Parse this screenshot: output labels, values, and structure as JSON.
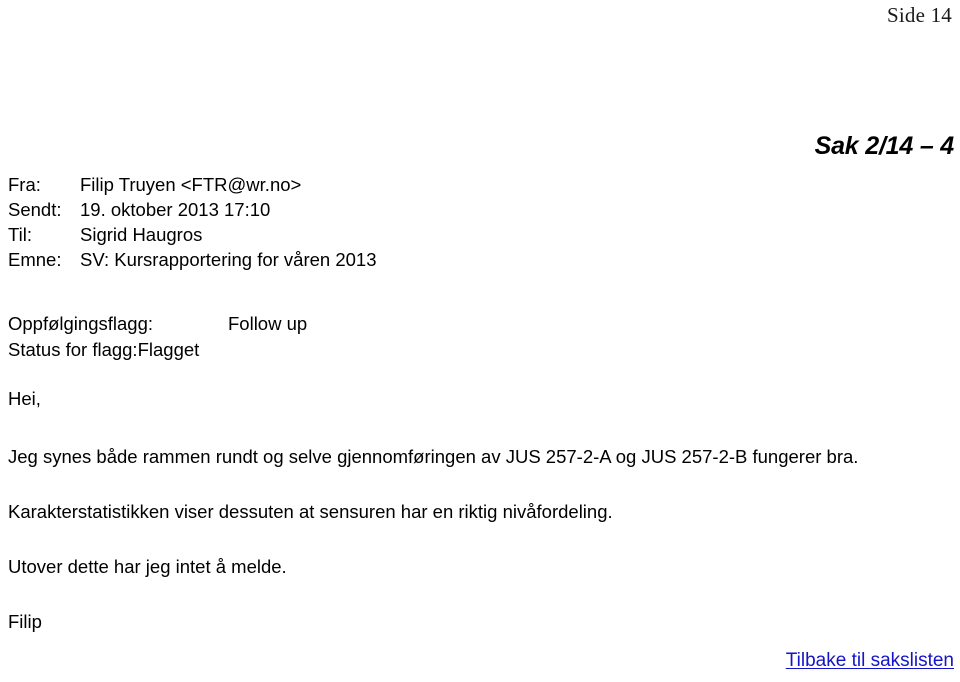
{
  "page": {
    "page_number_label": "Side 14",
    "case_reference": "Sak 2/14 – 4"
  },
  "email_header": {
    "rows": [
      {
        "label": "Fra:",
        "value": "Filip Truyen <FTR@wr.no>"
      },
      {
        "label": "Sendt:",
        "value": "19. oktober 2013 17:10"
      },
      {
        "label": "Til:",
        "value": "Sigrid Haugros"
      },
      {
        "label": "Emne:",
        "value": "SV: Kursrapportering for våren 2013"
      }
    ]
  },
  "flag_block": {
    "followup_label": "Oppfølgingsflagg:",
    "followup_value": "Follow up",
    "status_label": "Status for flagg:",
    "status_value": "Flagget"
  },
  "message_body": {
    "greeting": "Hei,",
    "paragraph_1": "Jeg synes både rammen rundt og selve gjennomføringen av JUS 257-2-A og JUS 257-2-B fungerer bra.",
    "paragraph_2": "Karakterstatistikken viser dessuten at sensuren har en riktig nivåfordeling.",
    "paragraph_3": "Utover dette har jeg intet å melde.",
    "signature": "Filip"
  },
  "footer": {
    "back_link_label": "Tilbake til sakslisten",
    "link_color": "#1414c8"
  }
}
